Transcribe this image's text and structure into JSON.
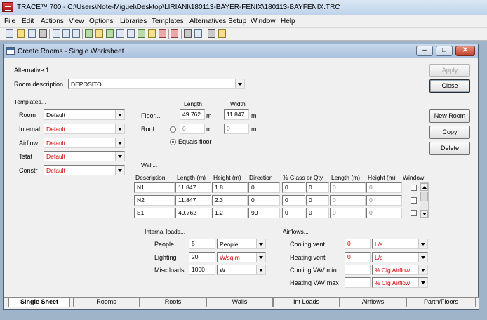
{
  "app": {
    "title": "TRACE™ 700 - C:\\Users\\Note-Miguel\\Desktop\\LIRIANI\\180113-BAYER-FENIX\\180113-BAYFENIX.TRC",
    "menu": [
      "File",
      "Edit",
      "Actions",
      "View",
      "Options",
      "Libraries",
      "Templates",
      "Alternatives Setup",
      "Window",
      "Help"
    ],
    "toolbar_icons": [
      "new-file-icon",
      "open-folder-icon",
      "save-icon",
      "print-icon",
      "cut-icon",
      "copy-icon",
      "paste-icon",
      "help-book-icon",
      "create-rooms-icon",
      "assign-rooms-icon",
      "check-icon",
      "building-icon",
      "weather-icon",
      "chart-icon",
      "graph-icon",
      "library-icon",
      "calculator-icon",
      "report-icon",
      "tools-icon",
      "whats-this-icon"
    ]
  },
  "window": {
    "title": "Create Rooms - Single Worksheet",
    "controls": {
      "minimize": "–",
      "maximize": "□",
      "close": "✕"
    }
  },
  "form": {
    "alternative": "Alternative 1",
    "room_description_label": "Room description",
    "room_description": "DEPOSITO",
    "templates_label": "Templates...",
    "templates": [
      {
        "label": "Room",
        "value": "Default",
        "color": "#000000"
      },
      {
        "label": "Internal",
        "value": "Default",
        "color": "#d40000"
      },
      {
        "label": "Airflow",
        "value": "Default",
        "color": "#d40000"
      },
      {
        "label": "Tstat",
        "value": "Default",
        "color": "#d40000"
      },
      {
        "label": "Constr",
        "value": "Default",
        "color": "#d40000"
      }
    ],
    "floor": {
      "label": "Floor...",
      "length_header": "Length",
      "width_header": "Width",
      "length": "49.762",
      "width": "11.847",
      "unit_length": "m",
      "unit_width": "m"
    },
    "roof": {
      "label": "Roof...",
      "length": "0",
      "width": "0",
      "unit_length": "m",
      "unit_width": "m",
      "equals_floor_label": "Equals floor",
      "equals_floor_selected": true
    },
    "wall": {
      "label": "Wall...",
      "headers": [
        "Description",
        "Length (m)",
        "Height (m)",
        "Direction",
        "% Glass or Qty",
        "Length (m)",
        "Height (m)",
        "Window"
      ],
      "rows": [
        [
          "N1",
          "11.847",
          "1.8",
          "0",
          "0",
          "0",
          "0",
          "0"
        ],
        [
          "N2",
          "11.847",
          "2.3",
          "0",
          "0",
          "0",
          "0",
          "0"
        ],
        [
          "E1",
          "49.762",
          "1.2",
          "90",
          "0",
          "0",
          "0",
          "0"
        ]
      ]
    },
    "internal_loads": {
      "label": "Internal loads...",
      "rows": [
        {
          "label": "People",
          "value": "5",
          "unit": "People",
          "unit_color": "#000000"
        },
        {
          "label": "Lighting",
          "value": "20",
          "unit": "W/sq m",
          "unit_color": "#d40000"
        },
        {
          "label": "Misc loads",
          "value": "1000",
          "unit": "W",
          "unit_color": "#000000"
        }
      ]
    },
    "airflows": {
      "label": "Airflows...",
      "rows": [
        {
          "label": "Cooling vent",
          "value": "0",
          "unit": "L/s"
        },
        {
          "label": "Heating vent",
          "value": "0",
          "unit": "L/s"
        },
        {
          "label": "Cooling VAV min",
          "value": "",
          "unit": "% Clg Airflow"
        },
        {
          "label": "Heating VAV max",
          "value": "",
          "unit": "% Clg Airflow"
        }
      ]
    }
  },
  "buttons": {
    "apply": "Apply",
    "close": "Close",
    "new_room": "New Room",
    "copy": "Copy",
    "delete": "Delete"
  },
  "tabs": [
    "Single Sheet",
    "Rooms",
    "Roofs",
    "Walls",
    "Int Loads",
    "Airflows",
    "Partn/Floors"
  ],
  "active_tab": "Single Sheet"
}
